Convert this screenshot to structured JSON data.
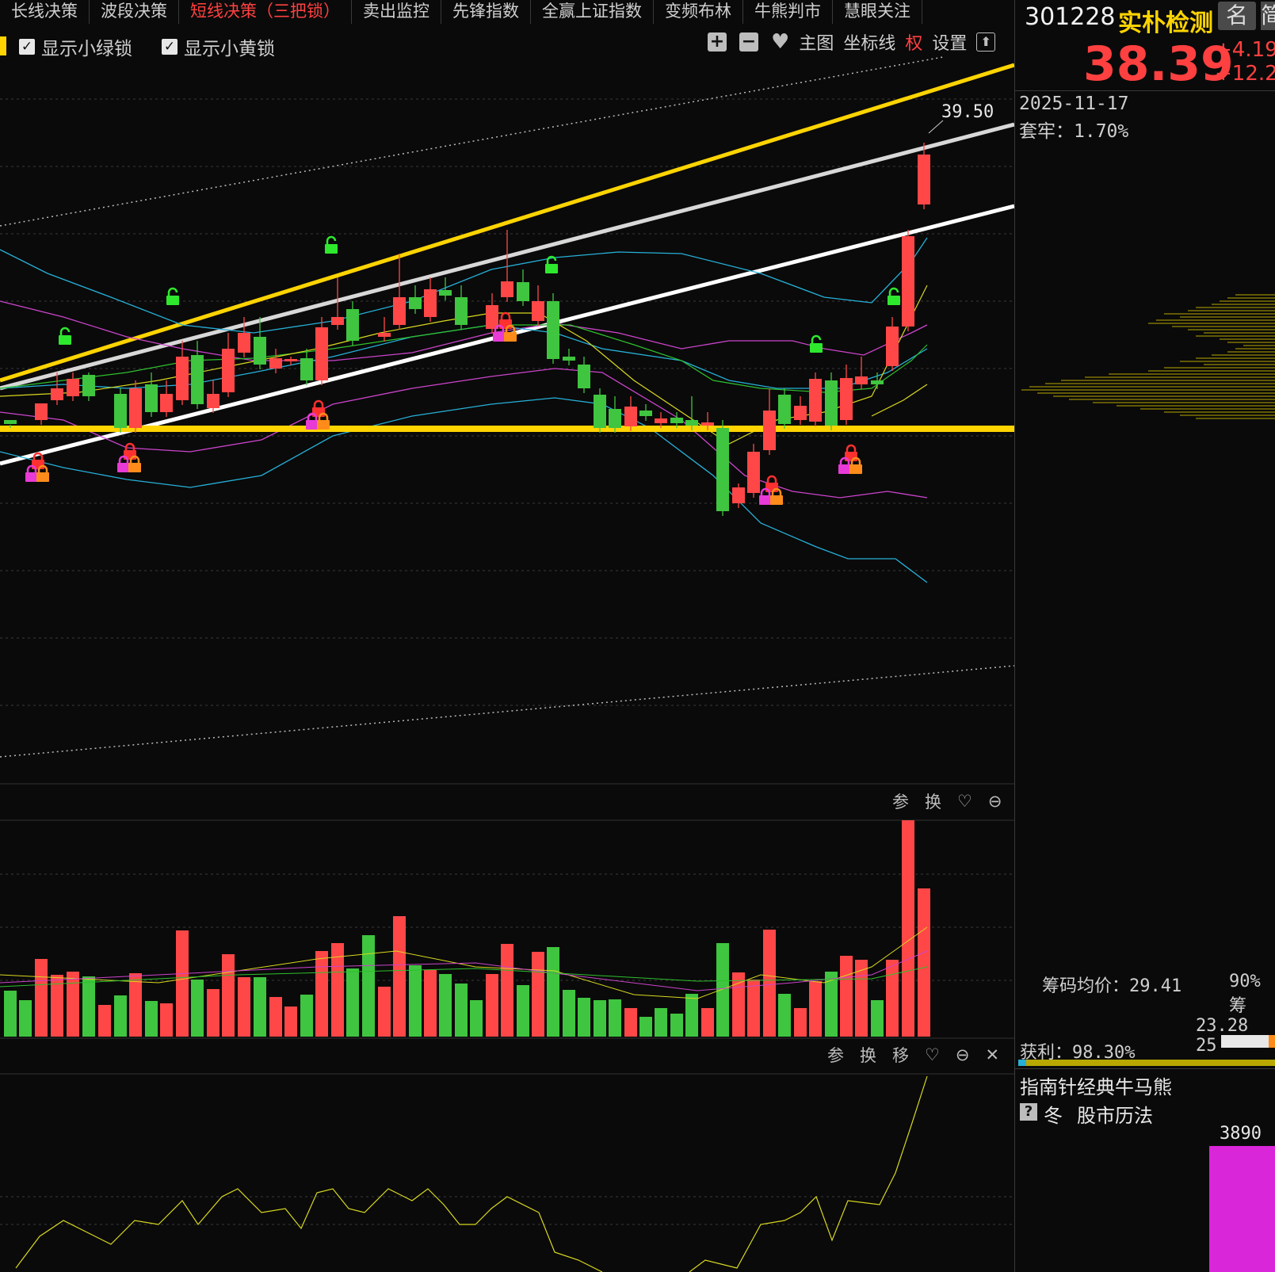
{
  "tabs": [
    "长线决策",
    "波段决策",
    "短线决策（三把锁）",
    "卖出监控",
    "先锋指数",
    "全赢上证指数",
    "变频布林",
    "牛熊判市",
    "慧眼关注"
  ],
  "active_tab_index": 2,
  "toolbar": {
    "show_green_lock": "显示小绿锁",
    "show_yellow_lock": "显示小黄锁",
    "plus": "+",
    "minus": "−",
    "main_chart": "主图",
    "axis_line": "坐标线",
    "quan": "权",
    "settings": "设置"
  },
  "price_label": "39.50",
  "panel_controls": {
    "volume": [
      "参",
      "换"
    ],
    "indicator": [
      "参",
      "换",
      "移"
    ]
  },
  "stock": {
    "code": "301228",
    "name": "实朴检测",
    "name_btn": "名",
    "name_btn2": "简",
    "price": "38.39",
    "change": "+4.19",
    "change_pct": "+12.2"
  },
  "chip": {
    "date": "2025-11-17",
    "trapped": "套牢：1.70%",
    "avg_cost": "筹码均价：29.41",
    "chip90": "90%筹",
    "range": "23.28 25",
    "profit": "获利：98.30%"
  },
  "compass": {
    "title": "指南针经典牛马熊",
    "season": "冬",
    "calendar": "股市历法",
    "bar_value": "3890"
  },
  "colors": {
    "up": "#ff4747",
    "down": "#3fc53f",
    "yellow": "#ffd400",
    "magenta": "#e03ad6",
    "cyan": "#26b0d8",
    "background": "#0a0a0a"
  }
}
